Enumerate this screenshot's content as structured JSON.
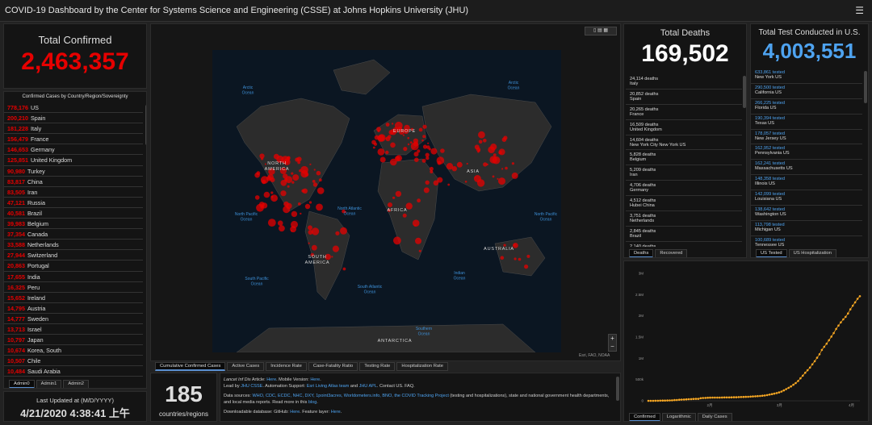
{
  "header": {
    "title": "COVID-19 Dashboard by the Center for Systems Science and Engineering (CSSE) at Johns Hopkins University (JHU)",
    "menu_icon": "hamburger-icon"
  },
  "total_confirmed": {
    "label": "Total Confirmed",
    "value": "2,463,357"
  },
  "country_list": {
    "header": "Confirmed Cases by Country/Region/Sovereignty",
    "items": [
      {
        "value": "778,176",
        "name": "US"
      },
      {
        "value": "200,210",
        "name": "Spain"
      },
      {
        "value": "181,228",
        "name": "Italy"
      },
      {
        "value": "156,479",
        "name": "France"
      },
      {
        "value": "146,653",
        "name": "Germany"
      },
      {
        "value": "125,851",
        "name": "United Kingdom"
      },
      {
        "value": "90,980",
        "name": "Turkey"
      },
      {
        "value": "83,817",
        "name": "China"
      },
      {
        "value": "83,505",
        "name": "Iran"
      },
      {
        "value": "47,121",
        "name": "Russia"
      },
      {
        "value": "40,581",
        "name": "Brazil"
      },
      {
        "value": "39,983",
        "name": "Belgium"
      },
      {
        "value": "37,354",
        "name": "Canada"
      },
      {
        "value": "33,588",
        "name": "Netherlands"
      },
      {
        "value": "27,944",
        "name": "Switzerland"
      },
      {
        "value": "20,863",
        "name": "Portugal"
      },
      {
        "value": "17,655",
        "name": "India"
      },
      {
        "value": "16,325",
        "name": "Peru"
      },
      {
        "value": "15,652",
        "name": "Ireland"
      },
      {
        "value": "14,795",
        "name": "Austria"
      },
      {
        "value": "14,777",
        "name": "Sweden"
      },
      {
        "value": "13,713",
        "name": "Israel"
      },
      {
        "value": "10,797",
        "name": "Japan"
      },
      {
        "value": "10,674",
        "name": "Korea, South"
      },
      {
        "value": "10,507",
        "name": "Chile"
      },
      {
        "value": "10,484",
        "name": "Saudi Arabia"
      }
    ]
  },
  "admin_tabs": [
    "Admin0",
    "Admin1",
    "Admin2"
  ],
  "last_updated": {
    "label": "Last Updated at (M/D/YYYY)",
    "value": "4/21/2020 4:38:41 上午"
  },
  "countries": {
    "value": "185",
    "label": "countries/regions"
  },
  "map": {
    "oceans": [
      {
        "key": "arctic1",
        "text": "Arctic Ocean"
      },
      {
        "key": "arctic2",
        "text": "Arctic Ocean"
      },
      {
        "key": "npac1",
        "text": "North Pacific Ocean"
      },
      {
        "key": "natl",
        "text": "North Atlantic Ocean"
      },
      {
        "key": "npac2",
        "text": "North Pacific Ocean"
      },
      {
        "key": "spac",
        "text": "South Pacific Ocean"
      },
      {
        "key": "satl",
        "text": "South Atlantic Ocean"
      },
      {
        "key": "indian",
        "text": "Indian Ocean"
      },
      {
        "key": "south",
        "text": "Southern Ocean"
      }
    ],
    "continents": [
      {
        "key": "na",
        "text": "NORTH AMERICA"
      },
      {
        "key": "sa",
        "text": "SOUTH AMERICA"
      },
      {
        "key": "eu",
        "text": "EUROPE"
      },
      {
        "key": "af",
        "text": "AFRICA"
      },
      {
        "key": "as",
        "text": "ASIA"
      },
      {
        "key": "au",
        "text": "AUSTRALIA"
      },
      {
        "key": "an",
        "text": "ANTARCTICA"
      }
    ],
    "attribution": "Esri, FAO, NOAA",
    "zoom_in": "+",
    "zoom_out": "−"
  },
  "map_tabs": [
    "Cumulative Confirmed Cases",
    "Active Cases",
    "Incidence Rate",
    "Case-Fatality Ratio",
    "Testing Rate",
    "Hospitalization Rate"
  ],
  "info_text": {
    "line1_a": "Lancet Inf Dis",
    "line1_b": " Article: ",
    "line1_c": "Here",
    "line1_d": ". Mobile Version: ",
    "line1_e": "Here",
    "line2_a": "Lead by ",
    "line2_b": "JHU CSSE",
    "line2_c": ". Automation Support: ",
    "line2_d": "Esri Living Atlas team",
    "line2_e": " and ",
    "line2_f": "JHU APL",
    "line2_g": ". Contact US. FAQ.",
    "line3_a": "Data sources: ",
    "line3_b": "WHO, CDC, ECDC, NHC, DXY, 1point3acres, Worldometers.info, BNO, the COVID Tracking Project",
    "line3_c": " (testing and hospitalizations), state and national government health departments, and local media reports. Read more in this ",
    "line3_d": "blog",
    "line4_a": "Downloadable database: GitHub: ",
    "line4_b": "Here",
    "line4_c": ". Feature layer: ",
    "line4_d": "Here"
  },
  "total_deaths": {
    "label": "Total Deaths",
    "value": "169,502",
    "items": [
      {
        "a": "24,114 deaths",
        "b": "Italy"
      },
      {
        "a": "20,852 deaths",
        "b": "Spain"
      },
      {
        "a": "20,265 deaths",
        "b": "France"
      },
      {
        "a": "16,509 deaths",
        "b": "United Kingdom"
      },
      {
        "a": "14,604 deaths",
        "b": "New York City New York US"
      },
      {
        "a": "5,828 deaths",
        "b": "Belgium"
      },
      {
        "a": "5,209 deaths",
        "b": "Iran"
      },
      {
        "a": "4,706 deaths",
        "b": "Germany"
      },
      {
        "a": "4,512 deaths",
        "b": "Hubei China"
      },
      {
        "a": "3,751 deaths",
        "b": "Netherlands"
      },
      {
        "a": "2,845 deaths",
        "b": "Brazil"
      },
      {
        "a": "2,140 deaths",
        "b": ""
      }
    ],
    "tabs": [
      "Deaths",
      "Recovered"
    ]
  },
  "total_tests": {
    "label": "Total Test Conducted in U.S.",
    "value": "4,003,551",
    "items": [
      {
        "a": "633,861 tested",
        "b": "New York US"
      },
      {
        "a": "290,500 tested",
        "b": "California US"
      },
      {
        "a": "266,225 tested",
        "b": "Florida US"
      },
      {
        "a": "190,394 tested",
        "b": "Texas US"
      },
      {
        "a": "178,057 tested",
        "b": "New Jersey US"
      },
      {
        "a": "162,952 tested",
        "b": "Pennsylvania US"
      },
      {
        "a": "162,241 tested",
        "b": "Massachusetts US"
      },
      {
        "a": "148,358 tested",
        "b": "Illinois US"
      },
      {
        "a": "142,099 tested",
        "b": "Louisiana US"
      },
      {
        "a": "138,642 tested",
        "b": "Washington US"
      },
      {
        "a": "113,798 tested",
        "b": "Michigan US"
      },
      {
        "a": "100,689 tested",
        "b": "Tennessee US"
      }
    ],
    "tabs": [
      "US Tested",
      "US Hospitalization"
    ]
  },
  "chart_tabs": [
    "Confirmed",
    "Logarithmic",
    "Daily Cases"
  ],
  "colors": {
    "confirmed": "#e60000",
    "deaths": "#ffffff",
    "tested": "#4ea3f0",
    "chart_line": "#f5a623"
  },
  "chart_data": {
    "type": "line",
    "title": "",
    "xlabel": "",
    "ylabel": "",
    "x_tick_labels": [
      "2月",
      "3月",
      "4月"
    ],
    "y_tick_labels": [
      "0",
      "500k",
      "1M",
      "1.5M",
      "2M",
      "2.5M",
      "3M"
    ],
    "ylim": [
      0,
      3000000
    ],
    "series": [
      {
        "values": [
          555,
          654,
          941,
          1434,
          2118,
          2927,
          5578,
          6166,
          8234,
          9927,
          12038,
          16787,
          19881,
          23892,
          27635,
          30794,
          34391,
          37120,
          40150,
          42762,
          44802,
          45221,
          60368,
          66885,
          69030,
          71224,
          73258,
          75136,
          75639,
          76197,
          76819,
          78572,
          78958,
          79561,
          80406,
          81388,
          82746,
          84112,
          86604,
          88585,
          90443,
          93016,
          95314,
          98425,
          102050,
          106099,
          109991,
          114381,
          118948,
          126214,
          134576,
          145483,
          156653,
          169593,
          182490,
          198238,
          218822,
          244933,
          275597,
          305036,
          337489,
          378287,
          418041,
          467653,
          529591,
          593291,
          660706,
          720117,
          782365,
          857487,
          932605,
          1013466,
          1095917,
          1197405,
          1272115,
          1345101,
          1426096,
          1511104,
          1595350,
          1691719,
          1771514,
          1846679,
          1917320,
          1976192,
          2056054,
          2152437,
          2240190,
          2317759,
          2401379,
          2463357
        ]
      }
    ],
    "grid": false,
    "legend": "none"
  }
}
